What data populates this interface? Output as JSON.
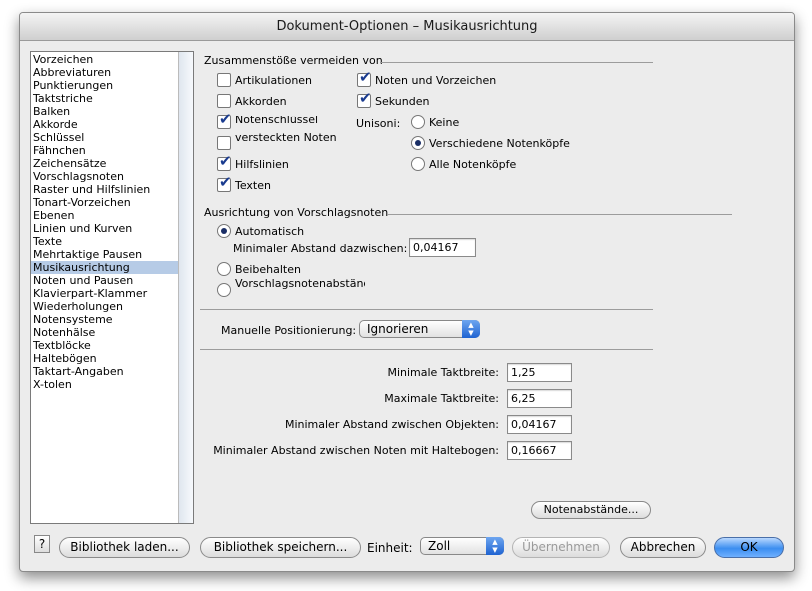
{
  "window": {
    "title": "Dokument-Optionen – Musikausrichtung"
  },
  "sidebar": {
    "items": [
      {
        "label": "Vorzeichen"
      },
      {
        "label": "Abbreviaturen"
      },
      {
        "label": "Punktierungen"
      },
      {
        "label": "Taktstriche"
      },
      {
        "label": "Balken"
      },
      {
        "label": "Akkorde"
      },
      {
        "label": "Schlüssel"
      },
      {
        "label": "Fähnchen"
      },
      {
        "label": "Zeichensätze"
      },
      {
        "label": "Vorschlagsnoten"
      },
      {
        "label": "Raster und Hilfslinien"
      },
      {
        "label": "Tonart-Vorzeichen"
      },
      {
        "label": "Ebenen"
      },
      {
        "label": "Linien und Kurven"
      },
      {
        "label": "Texte"
      },
      {
        "label": "Mehrtaktige Pausen"
      },
      {
        "label": "Musikausrichtung"
      },
      {
        "label": "Noten und Pausen"
      },
      {
        "label": "Klavierpart-Klammer"
      },
      {
        "label": "Wiederholungen"
      },
      {
        "label": "Notensysteme"
      },
      {
        "label": "Notenhälse"
      },
      {
        "label": "Textblöcke"
      },
      {
        "label": "Haltebögen"
      },
      {
        "label": "Taktart-Angaben"
      },
      {
        "label": "X-tolen"
      }
    ],
    "selected": "Musikausrichtung"
  },
  "collisions": {
    "title": "Zusammenstöße vermeiden von",
    "left": [
      {
        "label": "Artikulationen",
        "checked": false
      },
      {
        "label": "Akkorden",
        "checked": false
      },
      {
        "label": "Notenschlüssel",
        "checked": true
      },
      {
        "label": "versteckten Noten",
        "checked": false
      },
      {
        "label": "Hilfslinien",
        "checked": true
      },
      {
        "label": "Texten",
        "checked": true
      }
    ],
    "right": [
      {
        "label": "Noten und Vorzeichen",
        "checked": true
      },
      {
        "label": "Sekunden",
        "checked": true
      }
    ],
    "unisoni_label": "Unisoni:",
    "unisoni": [
      {
        "label": "Keine",
        "selected": false
      },
      {
        "label": "Verschiedene Notenköpfe",
        "selected": true
      },
      {
        "label": "Alle Notenköpfe",
        "selected": false
      }
    ]
  },
  "grace": {
    "title": "Ausrichtung von Vorschlagsnoten",
    "auto_label": "Automatisch",
    "min_dist_label": "Minimaler Abstand dazwischen:",
    "min_dist_value": "0,04167",
    "keep_label": "Beibehalten",
    "restore_label": "Vorschlagsnotenabstände wiederherstellen"
  },
  "manual": {
    "label": "Manuelle Positionierung:",
    "value": "Ignorieren"
  },
  "fields": [
    {
      "label": "Minimale Taktbreite:",
      "value": "1,25"
    },
    {
      "label": "Maximale Taktbreite:",
      "value": "6,25"
    },
    {
      "label": "Minimaler Abstand zwischen Objekten:",
      "value": "0,04167"
    },
    {
      "label": "Minimaler Abstand zwischen Noten mit Haltebogen:",
      "value": "0,16667"
    }
  ],
  "spacing_button": "Notenabstände...",
  "footer": {
    "help": "?",
    "load": "Bibliothek laden...",
    "save": "Bibliothek speichern...",
    "unit_label": "Einheit:",
    "unit_value": "Zoll",
    "apply": "Übernehmen",
    "cancel": "Abbrechen",
    "ok": "OK"
  }
}
